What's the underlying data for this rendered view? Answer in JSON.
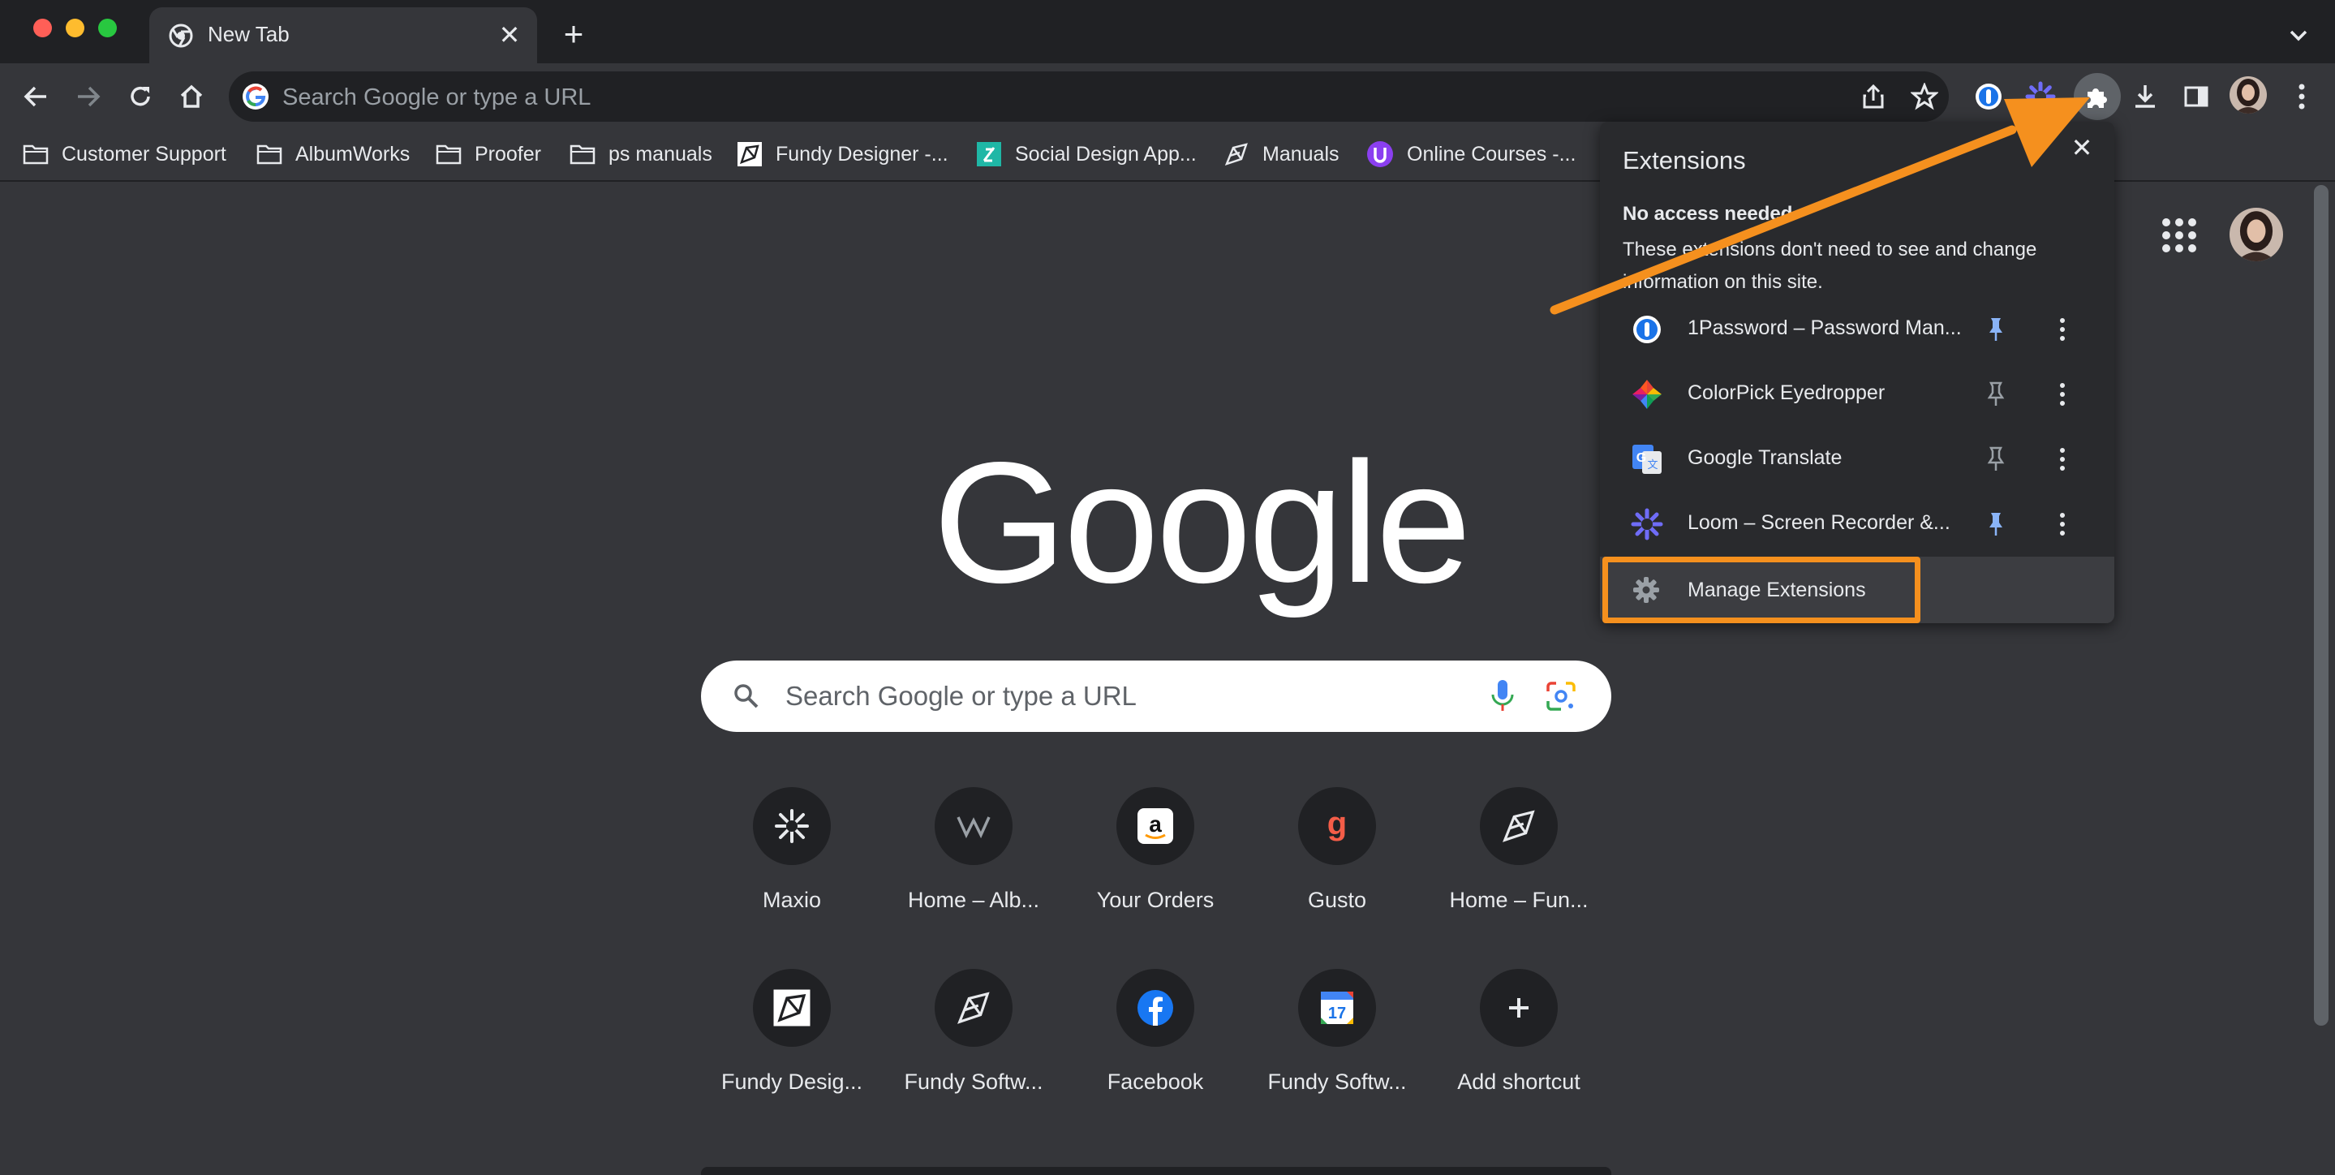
{
  "tab": {
    "title": "New Tab",
    "icon": "chrome-icon"
  },
  "omnibox": {
    "placeholder": "Search Google or type a URL"
  },
  "bookmarks": [
    {
      "label": "Customer Support",
      "icon": "folder-icon"
    },
    {
      "label": "AlbumWorks",
      "icon": "folder-icon"
    },
    {
      "label": "Proofer",
      "icon": "folder-icon"
    },
    {
      "label": "ps manuals",
      "icon": "folder-icon"
    },
    {
      "label": "Fundy Designer -...",
      "icon": "fundy-icon"
    },
    {
      "label": "Social Design App...",
      "icon": "social-design-icon"
    },
    {
      "label": "Manuals",
      "icon": "fundy-icon"
    },
    {
      "label": "Online Courses -...",
      "icon": "courses-icon"
    }
  ],
  "extensions_popup": {
    "title": "Extensions",
    "subtitle": "No access needed",
    "description": "These extensions don't need to see and change information on this site.",
    "items": [
      {
        "name": "1Password – Password Man...",
        "pinned": true,
        "icon": "onepassword-icon"
      },
      {
        "name": "ColorPick Eyedropper",
        "pinned": false,
        "icon": "colorpick-icon"
      },
      {
        "name": "Google Translate",
        "pinned": false,
        "icon": "translate-icon"
      },
      {
        "name": "Loom – Screen Recorder &...",
        "pinned": true,
        "icon": "loom-icon"
      }
    ],
    "manage_label": "Manage Extensions"
  },
  "ntp": {
    "logo_text": "Google",
    "search_placeholder": "Search Google or type a URL",
    "shortcuts": [
      {
        "label": "Maxio",
        "icon": "maxio-icon"
      },
      {
        "label": "Home – Alb...",
        "icon": "albumworks-icon"
      },
      {
        "label": "Your Orders",
        "icon": "amazon-icon"
      },
      {
        "label": "Gusto",
        "icon": "gusto-icon"
      },
      {
        "label": "Home – Fun...",
        "icon": "fundy-icon"
      },
      {
        "label": "Fundy Desig...",
        "icon": "fundy-designer-icon"
      },
      {
        "label": "Fundy Softw...",
        "icon": "fundy-icon"
      },
      {
        "label": "Facebook",
        "icon": "facebook-icon"
      },
      {
        "label": "Fundy Softw...",
        "icon": "calendar-icon"
      },
      {
        "label": "Add shortcut",
        "icon": "plus-icon"
      }
    ]
  },
  "colors": {
    "highlight": "#f5901e",
    "pin_active": "#8ab4f8",
    "tab_strip": "#202124",
    "toolbar": "#35363a"
  }
}
